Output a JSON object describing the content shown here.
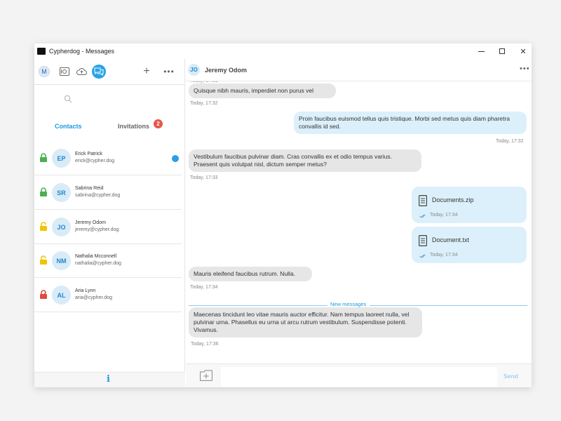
{
  "window": {
    "title": "Cypherdog - Messages"
  },
  "sidebar": {
    "user_initial": "M",
    "search_placeholder": "",
    "tabs": {
      "contacts": "Contacts",
      "invitations": "Invitations",
      "invitations_count": "2"
    },
    "contacts": [
      {
        "initials": "EP",
        "name": "Erick Patrick",
        "email": "erick@cypher.dog",
        "lock": "locked",
        "lock_color": "#4caf50",
        "unread": true
      },
      {
        "initials": "SR",
        "name": "Sabrina Reid",
        "email": "sabrina@cypher.dog",
        "lock": "locked",
        "lock_color": "#4caf50",
        "unread": false
      },
      {
        "initials": "JO",
        "name": "Jeremy Odom",
        "email": "jeremy@cypher.dog",
        "lock": "unlocked",
        "lock_color": "#f2c400",
        "unread": false
      },
      {
        "initials": "NM",
        "name": "Nathalia Mcconnell",
        "email": "nathalia@cypher.dog",
        "lock": "unlocked",
        "lock_color": "#f2c400",
        "unread": false
      },
      {
        "initials": "AL",
        "name": "Aria Lynn",
        "email": "aria@cypher.dog",
        "lock": "broken",
        "lock_color": "#e04b3d",
        "unread": false
      }
    ],
    "footer_icon": "i"
  },
  "chat": {
    "contact_initials": "JO",
    "contact_name": "Jeremy Odom",
    "messages": [
      {
        "type": "in",
        "text": "Quisque nibh mauris, imperdiet non purus vel",
        "time": "Today, 17:32"
      },
      {
        "type": "out",
        "text": "Proin faucibus euismod tellus quis tristique. Morbi sed metus quis diam pharetra convallis id sed.",
        "time": "Today, 17:32"
      },
      {
        "type": "in",
        "text": "Vestibulum faucibus pulvinar diam. Cras convallis ex et odio tempus varius. Praesent quis volutpat nisl, dictum semper metus?",
        "time": "Today, 17:33"
      },
      {
        "type": "file",
        "file_name": "Documents.zip",
        "time": "Today, 17:34"
      },
      {
        "type": "file",
        "file_name": "Document.txt",
        "time": "Today, 17:34"
      },
      {
        "type": "in",
        "text": "Mauris eleifend faucibus rutrum. Nulla.",
        "time": "Today, 17:34"
      },
      {
        "type": "in",
        "text": "Maecenas tincidunt leo vitae mauris auctor efficitur. Nam tempus laoreet nulla, vel pulvinar urna. Phasellus eu urna ut arcu rutrum vestibulum. Suspendisse potenti. Vivamus.",
        "time": "Today, 17:36"
      }
    ],
    "new_messages_label": "New messages",
    "composer": {
      "placeholder": "",
      "send_label": "Send"
    }
  },
  "colors": {
    "accent": "#1a9ae0",
    "badge": "#e8564a",
    "bubble_in": "#e6e6e6",
    "bubble_out": "#dcf0fb"
  }
}
